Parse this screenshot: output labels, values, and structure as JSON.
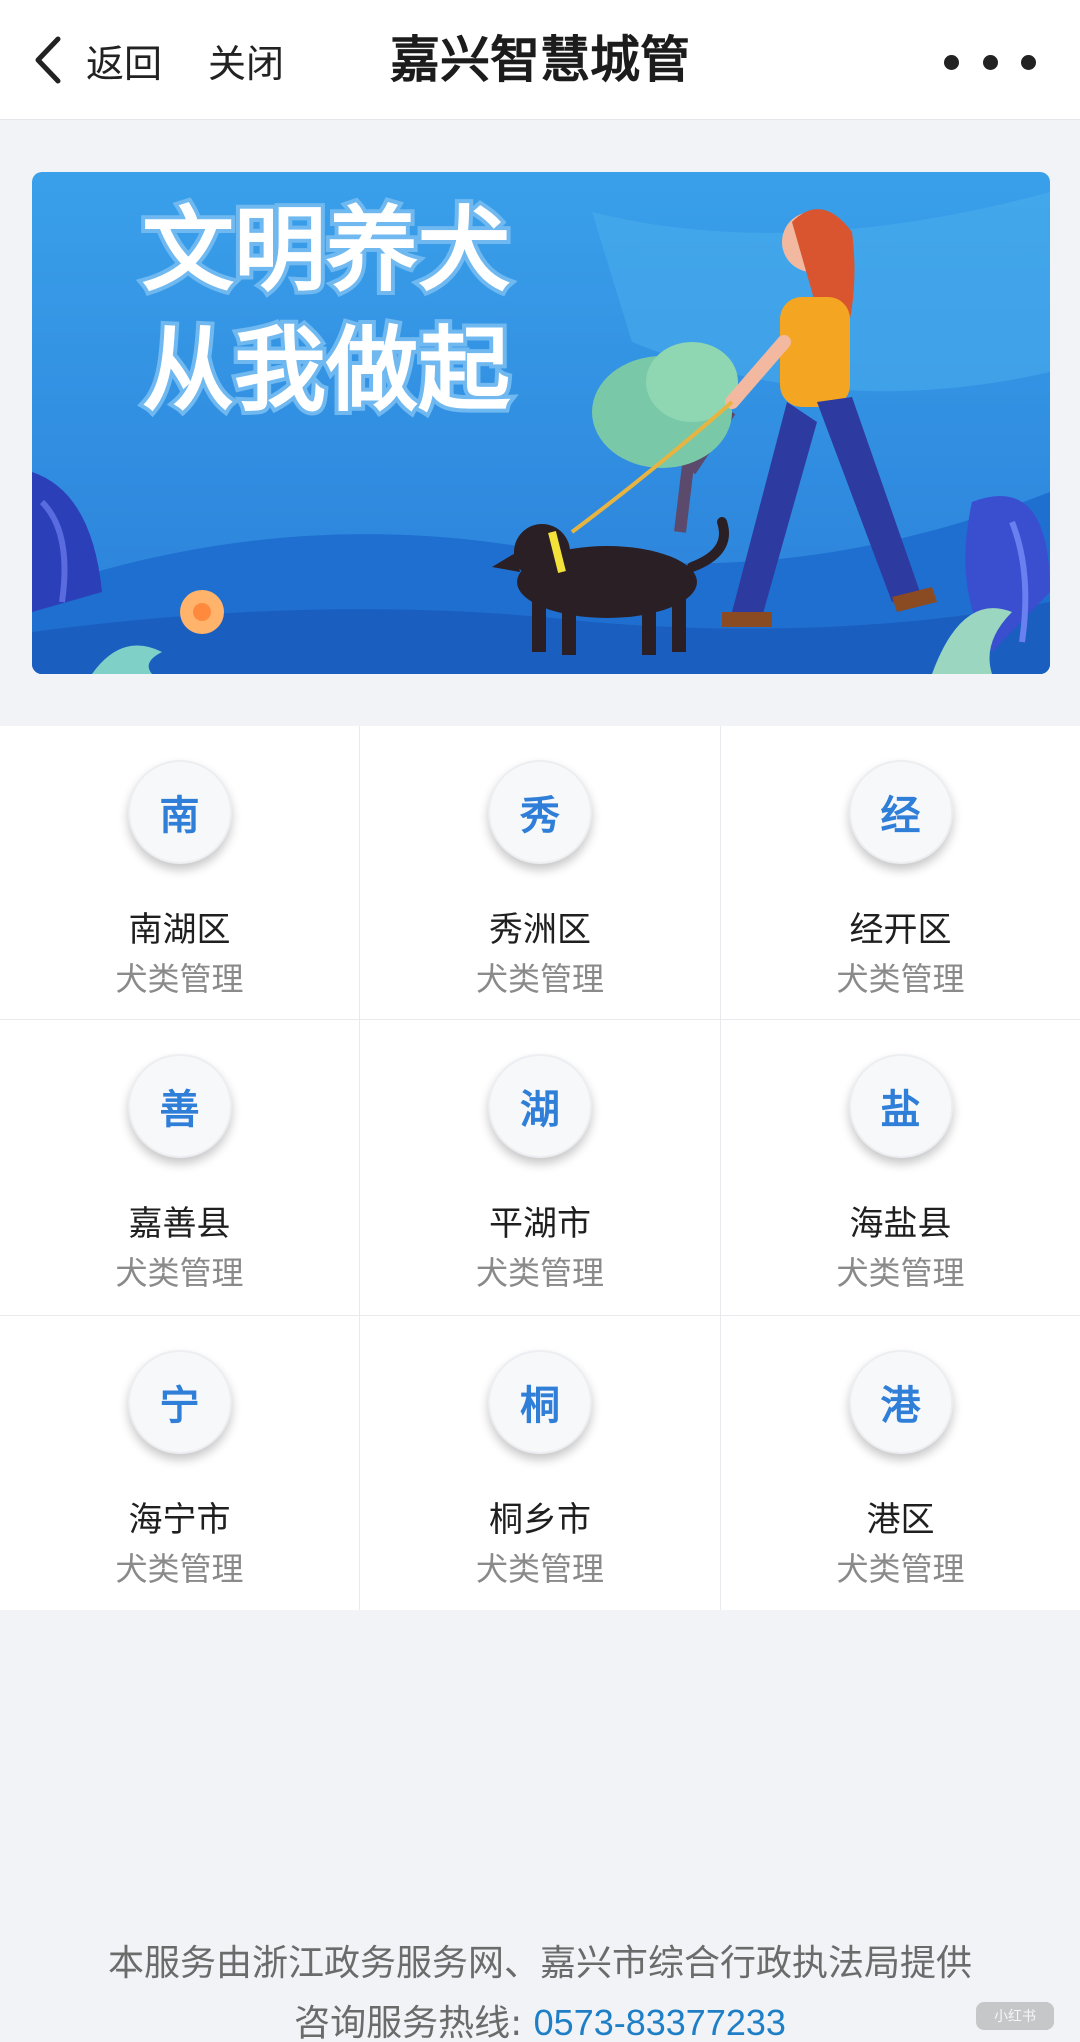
{
  "header": {
    "back_label": "返回",
    "close_label": "关闭",
    "title": "嘉兴智慧城管",
    "more_icon": "more-dots-icon"
  },
  "banner": {
    "line1": "文明养犬",
    "line2": "从我做起"
  },
  "districts": [
    {
      "badge": "南",
      "name": "南湖区",
      "subtitle": "犬类管理"
    },
    {
      "badge": "秀",
      "name": "秀洲区",
      "subtitle": "犬类管理"
    },
    {
      "badge": "经",
      "name": "经开区",
      "subtitle": "犬类管理"
    },
    {
      "badge": "善",
      "name": "嘉善县",
      "subtitle": "犬类管理"
    },
    {
      "badge": "湖",
      "name": "平湖市",
      "subtitle": "犬类管理"
    },
    {
      "badge": "盐",
      "name": "海盐县",
      "subtitle": "犬类管理"
    },
    {
      "badge": "宁",
      "name": "海宁市",
      "subtitle": "犬类管理"
    },
    {
      "badge": "桐",
      "name": "桐乡市",
      "subtitle": "犬类管理"
    },
    {
      "badge": "港",
      "name": "港区",
      "subtitle": "犬类管理"
    }
  ],
  "footer": {
    "provider": "本服务由浙江政务服务网、嘉兴市综合行政执法局提供",
    "hotline_label": "咨询服务热线: ",
    "hotline_number": "0573-83377233"
  },
  "watermark": "小红书",
  "colors": {
    "accent": "#2f7ed8",
    "link": "#1f7fc6",
    "banner_sky": "#2a8fe0"
  }
}
